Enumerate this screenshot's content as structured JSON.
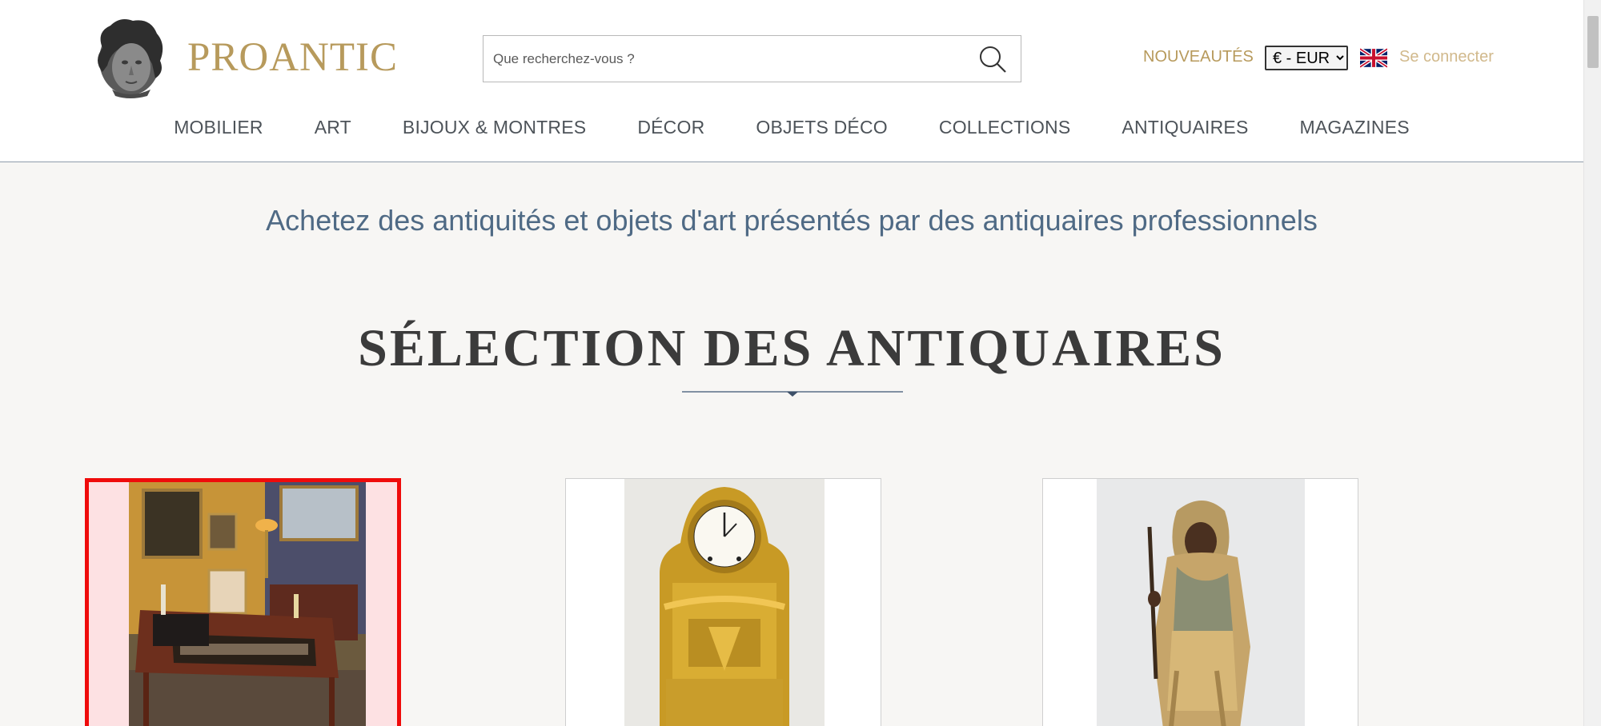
{
  "header": {
    "logo_text": "PROANTIC",
    "search": {
      "placeholder": "Que recherchez-vous ?"
    },
    "nouveautes_label": "NOUVEAUTÉS",
    "currency": {
      "selected": "€ - EUR"
    },
    "language_flag": "uk-flag-icon",
    "login_label": "Se connecter"
  },
  "nav": {
    "items": [
      {
        "label": "MOBILIER"
      },
      {
        "label": "ART"
      },
      {
        "label": "BIJOUX & MONTRES"
      },
      {
        "label": "DÉCOR"
      },
      {
        "label": "OBJETS DÉCO"
      },
      {
        "label": "COLLECTIONS"
      },
      {
        "label": "ANTIQUAIRES"
      },
      {
        "label": "MAGAZINES"
      }
    ]
  },
  "main": {
    "tagline": "Achetez des antiquités et objets d'art présentés par des antiquaires professionnels",
    "section_title": "SÉLECTION DES ANTIQUAIRES",
    "products": [
      {
        "image": "games-table-interior-photo",
        "selected": true
      },
      {
        "image": "gilt-bronze-mantel-clock-photo",
        "selected": false
      },
      {
        "image": "orientalist-figure-sculpture-photo",
        "selected": false
      }
    ]
  },
  "colors": {
    "brand_gold": "#b79a5c",
    "tagline_blue": "#4f6a85",
    "selection_red": "#ef0b0b"
  }
}
